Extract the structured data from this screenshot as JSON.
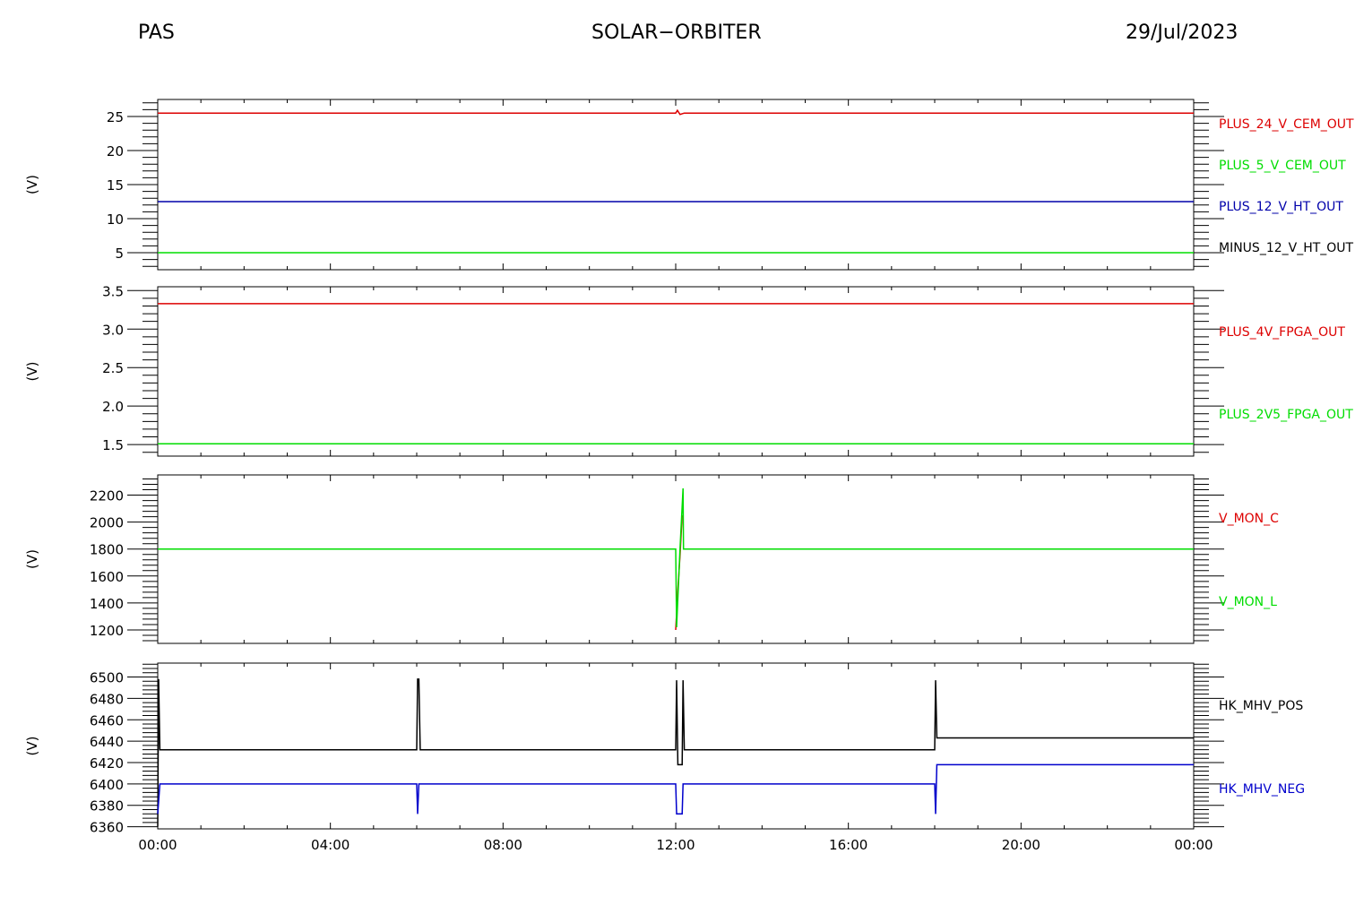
{
  "header": {
    "left": "PAS",
    "center": "SOLAR−ORBITER",
    "right": "29/Jul/2023"
  },
  "colors": {
    "red": "#dd0000",
    "green": "#00dd00",
    "blue": "#0000aa",
    "black": "#000000"
  },
  "chart_data": {
    "type": "line",
    "x_tick_labels": [
      "00:00",
      "04:00",
      "08:00",
      "12:00",
      "16:00",
      "20:00",
      "00:00"
    ],
    "x_range_hours": [
      0,
      24
    ],
    "panels": [
      {
        "ylabel": "(V)",
        "ylim": [
          2.5,
          27.5
        ],
        "yticks": [
          5,
          10,
          15,
          20,
          25
        ],
        "tick_labels": [
          "5",
          "10",
          "15",
          "20",
          "25"
        ],
        "series": [
          {
            "name": "PLUS_24_V_CEM_OUT",
            "color": "#dd0000",
            "points": [
              [
                0,
                25.5
              ],
              [
                12.0,
                25.5
              ],
              [
                12.04,
                25.9
              ],
              [
                12.1,
                25.3
              ],
              [
                12.2,
                25.5
              ],
              [
                24,
                25.5
              ]
            ]
          },
          {
            "name": "PLUS_5_V_CEM_OUT",
            "color": "#00dd00",
            "points": [
              [
                0,
                5.0
              ],
              [
                24,
                5.0
              ]
            ]
          },
          {
            "name": "PLUS_12_V_HT_OUT",
            "color": "#0000aa",
            "points": [
              [
                0,
                12.5
              ],
              [
                24,
                12.5
              ]
            ]
          },
          {
            "name": "MINUS_12_V_HT_OUT",
            "color": "#000000",
            "points": []
          }
        ]
      },
      {
        "ylabel": "(V)",
        "ylim": [
          1.35,
          3.55
        ],
        "yticks": [
          1.5,
          2.0,
          2.5,
          3.0,
          3.5
        ],
        "tick_labels": [
          "1.5",
          "2.0",
          "2.5",
          "3.0",
          "3.5"
        ],
        "series": [
          {
            "name": "PLUS_4V_FPGA_OUT",
            "color": "#dd0000",
            "points": [
              [
                0,
                3.33
              ],
              [
                24,
                3.33
              ]
            ]
          },
          {
            "name": "PLUS_2V5_FPGA_OUT",
            "color": "#00dd00",
            "points": [
              [
                0,
                1.51
              ],
              [
                24,
                1.51
              ]
            ]
          }
        ]
      },
      {
        "ylabel": "(V)",
        "ylim": [
          1100,
          2350
        ],
        "yticks": [
          1200,
          1400,
          1600,
          1800,
          2000,
          2200
        ],
        "tick_labels": [
          "1200",
          "1400",
          "1600",
          "1800",
          "2000",
          "2200"
        ],
        "series": [
          {
            "name": "V_MON_C",
            "color": "#dd0000",
            "points": [
              [
                12.0,
                1200
              ],
              [
                12.05,
                1500
              ],
              [
                12.1,
                1750
              ],
              [
                12.15,
                2050
              ]
            ]
          },
          {
            "name": "V_MON_L",
            "color": "#00dd00",
            "points": [
              [
                0,
                1800
              ],
              [
                12.0,
                1800
              ],
              [
                12.02,
                1220
              ],
              [
                12.1,
                1800
              ],
              [
                12.17,
                2250
              ],
              [
                12.18,
                1800
              ],
              [
                24,
                1800
              ]
            ]
          }
        ]
      },
      {
        "ylabel": "(V)",
        "ylim": [
          6358,
          6513
        ],
        "yticks": [
          6360,
          6380,
          6400,
          6420,
          6440,
          6460,
          6480,
          6500
        ],
        "tick_labels": [
          "6360",
          "6380",
          "6400",
          "6420",
          "6440",
          "6460",
          "6480",
          "6500"
        ],
        "series": [
          {
            "name": "HK_MHV_POS",
            "color": "#000000",
            "points": [
              [
                0,
                6360
              ],
              [
                0.02,
                6498
              ],
              [
                0.05,
                6432
              ],
              [
                6.0,
                6432
              ],
              [
                6.02,
                6498
              ],
              [
                6.05,
                6498
              ],
              [
                6.08,
                6432
              ],
              [
                12.0,
                6432
              ],
              [
                12.02,
                6497
              ],
              [
                12.05,
                6418
              ],
              [
                12.15,
                6418
              ],
              [
                12.17,
                6497
              ],
              [
                12.2,
                6432
              ],
              [
                18.0,
                6432
              ],
              [
                18.02,
                6497
              ],
              [
                18.05,
                6443
              ],
              [
                24,
                6443
              ]
            ]
          },
          {
            "name": "HK_MHV_NEG",
            "color": "#0000cc",
            "points": [
              [
                0,
                6372
              ],
              [
                0.05,
                6400
              ],
              [
                6.0,
                6400
              ],
              [
                6.02,
                6372
              ],
              [
                6.05,
                6400
              ],
              [
                12.0,
                6400
              ],
              [
                12.02,
                6372
              ],
              [
                12.15,
                6372
              ],
              [
                12.17,
                6400
              ],
              [
                18.0,
                6400
              ],
              [
                18.02,
                6372
              ],
              [
                18.05,
                6418
              ],
              [
                24,
                6418
              ]
            ]
          }
        ]
      }
    ]
  }
}
